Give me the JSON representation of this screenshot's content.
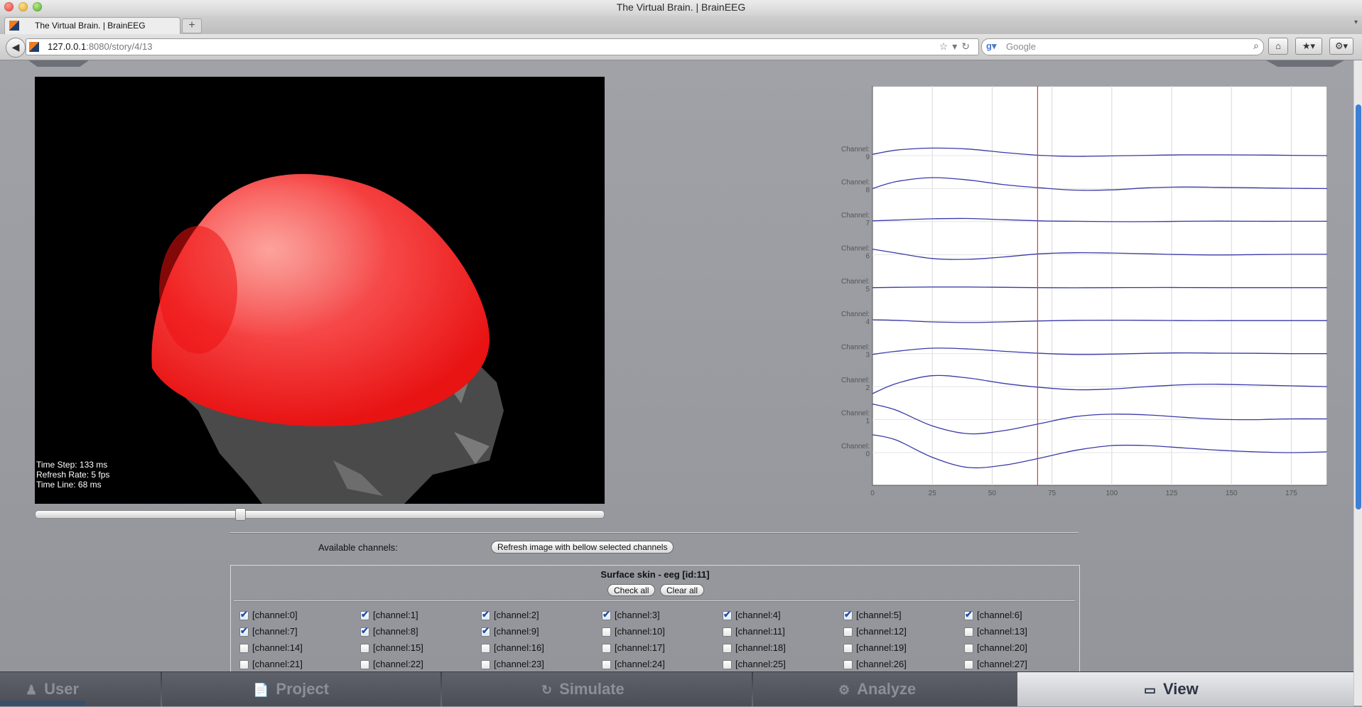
{
  "window": {
    "title": "The Virtual Brain. | BrainEEG"
  },
  "tab": {
    "title": "The Virtual Brain. | BrainEEG",
    "new_tab_label": "+",
    "tab_menu_label": "▾"
  },
  "nav": {
    "back_label": "◀",
    "url_host": "127.0.0.1",
    "url_path": ":8080/story/4/13",
    "url_icons": "☆▾↻",
    "search_engine_glyph": "g▾",
    "search_placeholder": "Google",
    "search_icon": "⌕",
    "home_label": "⌂",
    "bookmarks_label": "★▾",
    "tools_label": "⚙▾"
  },
  "viewer": {
    "time_step": "Time Step: 133 ms",
    "refresh_rate": "Refresh Rate: 5 fps",
    "time_line": "Time Line: 68 ms",
    "timeline_position": 0.36
  },
  "chart_data": {
    "type": "line",
    "x_ticks": [
      "0",
      "25",
      "50",
      "75",
      "100",
      "125",
      "150",
      "175"
    ],
    "xlim": [
      0,
      190
    ],
    "cursor_x": 69,
    "grid": true,
    "series_color": "#3a3aa8",
    "cursor_color": "#d63a3a",
    "channels": [
      {
        "label": "Channel:",
        "index": "9",
        "x": [
          0,
          10,
          25,
          40,
          55,
          70,
          85,
          100,
          115,
          130,
          145,
          160,
          175,
          190
        ],
        "y": [
          0.08,
          0.35,
          0.48,
          0.42,
          0.2,
          0.02,
          -0.05,
          -0.02,
          0.02,
          0.05,
          0.05,
          0.04,
          0.02,
          0.0
        ]
      },
      {
        "label": "Channel:",
        "index": "8",
        "x": [
          0,
          10,
          25,
          40,
          55,
          70,
          85,
          100,
          115,
          130,
          145,
          160,
          175,
          190
        ],
        "y": [
          0.0,
          0.45,
          0.7,
          0.55,
          0.25,
          0.05,
          -0.1,
          -0.08,
          0.05,
          0.1,
          0.08,
          0.05,
          0.02,
          0.0
        ]
      },
      {
        "label": "Channel:",
        "index": "7",
        "x": [
          0,
          10,
          25,
          40,
          55,
          70,
          85,
          100,
          115,
          130,
          145,
          160,
          175,
          190
        ],
        "y": [
          0.05,
          0.1,
          0.18,
          0.2,
          0.12,
          0.05,
          0.02,
          0.0,
          0.0,
          0.02,
          0.03,
          0.02,
          0.02,
          0.02
        ]
      },
      {
        "label": "Channel:",
        "index": "6",
        "x": [
          0,
          10,
          25,
          40,
          55,
          70,
          85,
          100,
          115,
          130,
          145,
          160,
          175,
          190
        ],
        "y": [
          0.35,
          0.1,
          -0.25,
          -0.3,
          -0.15,
          0.05,
          0.12,
          0.1,
          0.05,
          0.0,
          -0.02,
          0.0,
          0.02,
          0.02
        ]
      },
      {
        "label": "Channel:",
        "index": "5",
        "x": [
          0,
          10,
          25,
          40,
          55,
          70,
          85,
          100,
          115,
          130,
          145,
          160,
          175,
          190
        ],
        "y": [
          0.0,
          0.02,
          0.04,
          0.04,
          0.02,
          0.0,
          -0.01,
          0.0,
          0.01,
          0.01,
          0.0,
          0.0,
          0.0,
          0.0
        ]
      },
      {
        "label": "Channel:",
        "index": "4",
        "x": [
          0,
          10,
          25,
          40,
          55,
          70,
          85,
          100,
          115,
          130,
          145,
          160,
          175,
          190
        ],
        "y": [
          0.05,
          0.02,
          -0.08,
          -0.12,
          -0.08,
          -0.02,
          0.02,
          0.03,
          0.02,
          0.0,
          0.0,
          0.0,
          0.0,
          0.0
        ]
      },
      {
        "label": "Channel:",
        "index": "3",
        "x": [
          0,
          10,
          25,
          40,
          55,
          70,
          85,
          100,
          115,
          130,
          145,
          160,
          175,
          190
        ],
        "y": [
          -0.05,
          0.15,
          0.35,
          0.3,
          0.15,
          0.02,
          -0.05,
          -0.03,
          0.02,
          0.05,
          0.03,
          0.02,
          0.0,
          0.0
        ]
      },
      {
        "label": "Channel:",
        "index": "2",
        "x": [
          0,
          10,
          25,
          40,
          55,
          70,
          85,
          100,
          115,
          130,
          145,
          160,
          175,
          190
        ],
        "y": [
          -0.45,
          0.2,
          0.7,
          0.55,
          0.2,
          -0.05,
          -0.2,
          -0.15,
          0.0,
          0.12,
          0.15,
          0.1,
          0.05,
          0.0
        ]
      },
      {
        "label": "Channel:",
        "index": "1",
        "x": [
          0,
          10,
          25,
          40,
          55,
          70,
          85,
          100,
          115,
          130,
          145,
          160,
          175,
          190
        ],
        "y": [
          1.0,
          0.6,
          -0.4,
          -0.9,
          -0.7,
          -0.25,
          0.2,
          0.35,
          0.3,
          0.15,
          0.02,
          0.0,
          0.05,
          0.05
        ]
      },
      {
        "label": "Channel:",
        "index": "0",
        "x": [
          0,
          10,
          25,
          40,
          55,
          70,
          85,
          100,
          115,
          130,
          145,
          160,
          175,
          190
        ],
        "y": [
          1.15,
          0.8,
          -0.3,
          -0.95,
          -0.8,
          -0.35,
          0.15,
          0.45,
          0.45,
          0.3,
          0.15,
          0.05,
          0.0,
          0.05
        ]
      }
    ]
  },
  "channels_section": {
    "available_label": "Available channels:",
    "refresh_button": "Refresh image with bellow selected channels",
    "group_title": "Surface skin - eeg [id:11]",
    "check_all_label": "Check all",
    "clear_all_label": "Clear all",
    "items": [
      {
        "label": "[channel:0]",
        "checked": true
      },
      {
        "label": "[channel:1]",
        "checked": true
      },
      {
        "label": "[channel:2]",
        "checked": true
      },
      {
        "label": "[channel:3]",
        "checked": true
      },
      {
        "label": "[channel:4]",
        "checked": true
      },
      {
        "label": "[channel:5]",
        "checked": true
      },
      {
        "label": "[channel:6]",
        "checked": true
      },
      {
        "label": "[channel:7]",
        "checked": true
      },
      {
        "label": "[channel:8]",
        "checked": true
      },
      {
        "label": "[channel:9]",
        "checked": true
      },
      {
        "label": "[channel:10]",
        "checked": false
      },
      {
        "label": "[channel:11]",
        "checked": false
      },
      {
        "label": "[channel:12]",
        "checked": false
      },
      {
        "label": "[channel:13]",
        "checked": false
      },
      {
        "label": "[channel:14]",
        "checked": false
      },
      {
        "label": "[channel:15]",
        "checked": false
      },
      {
        "label": "[channel:16]",
        "checked": false
      },
      {
        "label": "[channel:17]",
        "checked": false
      },
      {
        "label": "[channel:18]",
        "checked": false
      },
      {
        "label": "[channel:19]",
        "checked": false
      },
      {
        "label": "[channel:20]",
        "checked": false
      },
      {
        "label": "[channel:21]",
        "checked": false
      },
      {
        "label": "[channel:22]",
        "checked": false
      },
      {
        "label": "[channel:23]",
        "checked": false
      },
      {
        "label": "[channel:24]",
        "checked": false
      },
      {
        "label": "[channel:25]",
        "checked": false
      },
      {
        "label": "[channel:26]",
        "checked": false
      },
      {
        "label": "[channel:27]",
        "checked": false
      }
    ]
  },
  "bottom_nav": {
    "user": "User",
    "project": "Project",
    "simulate": "Simulate",
    "analyze": "Analyze",
    "view": "View",
    "active": "view"
  }
}
